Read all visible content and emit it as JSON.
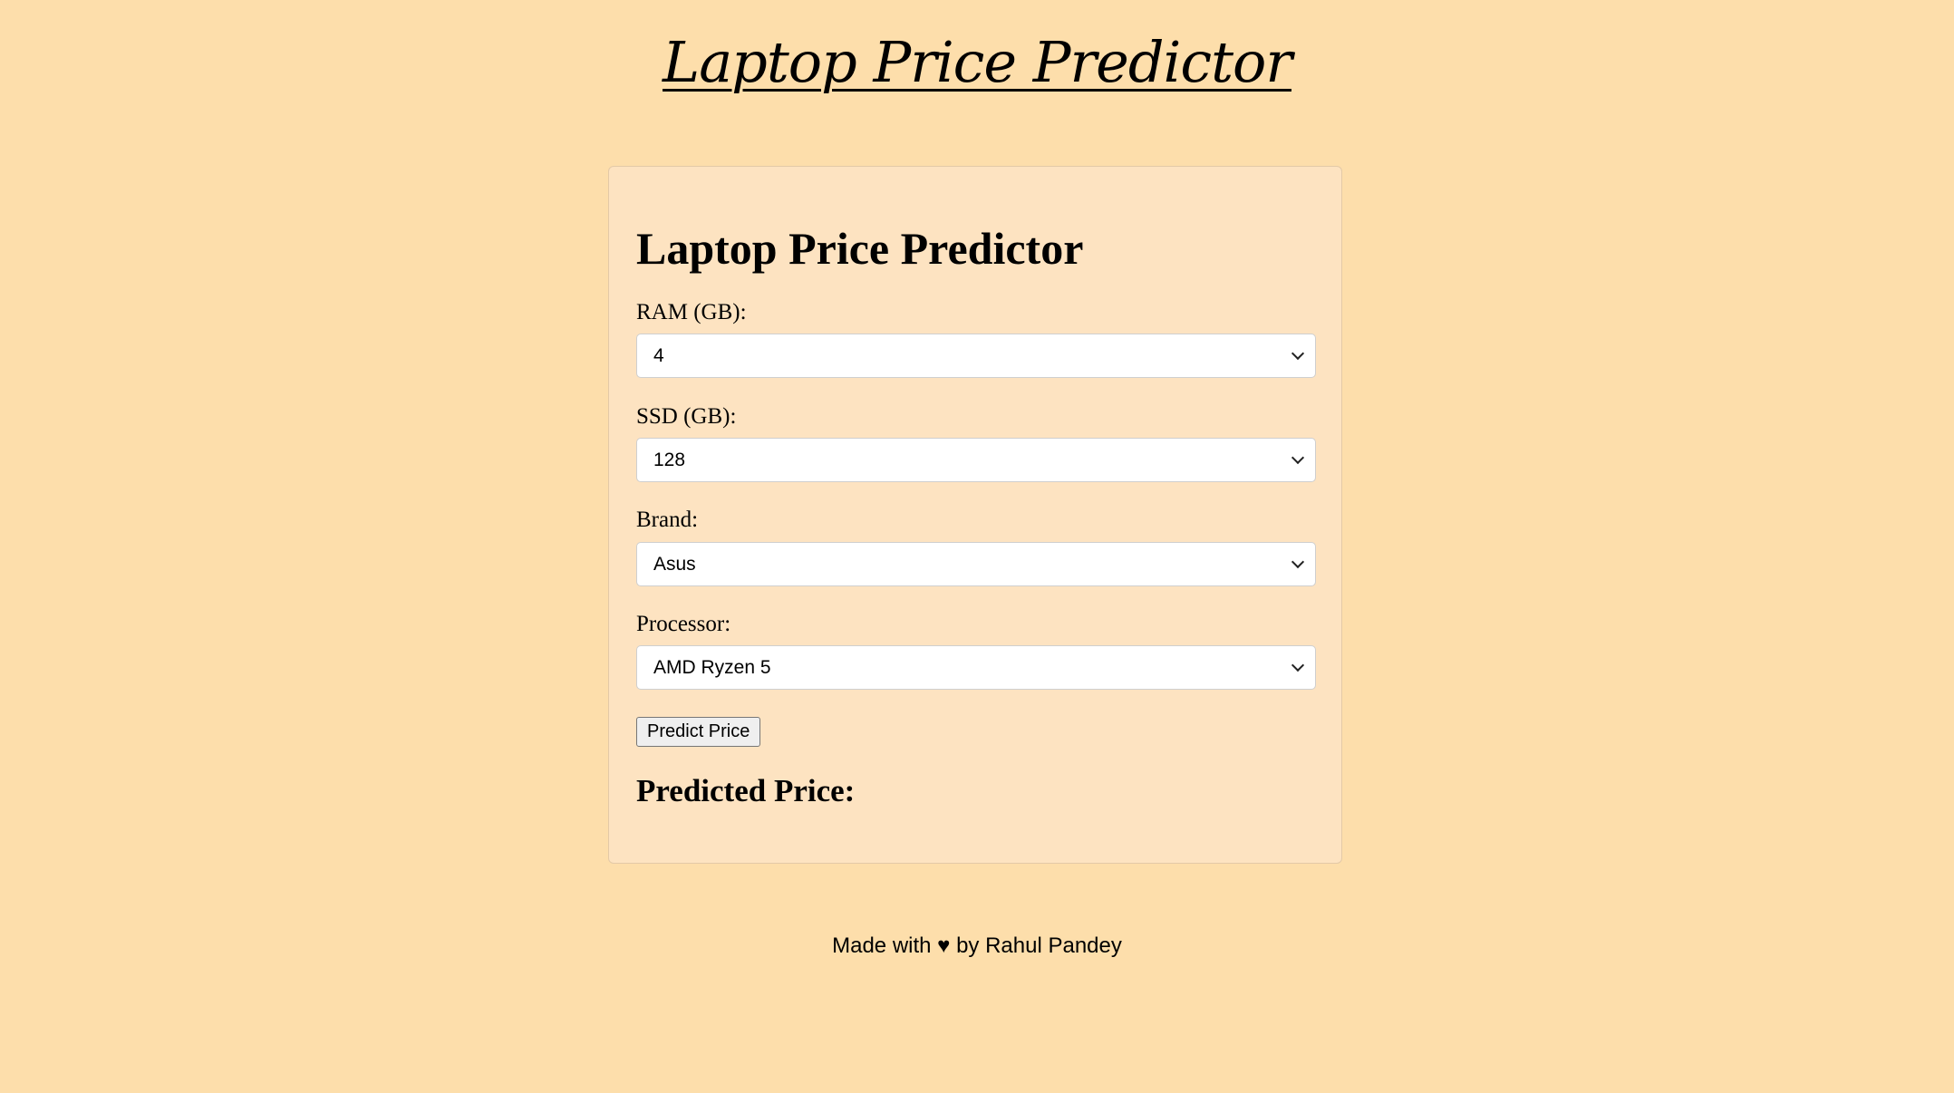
{
  "header": {
    "title": "Laptop Price Predictor"
  },
  "card": {
    "title": "Laptop Price Predictor",
    "fields": [
      {
        "label": "RAM (GB):",
        "value": "4"
      },
      {
        "label": "SSD (GB):",
        "value": "128"
      },
      {
        "label": "Brand:",
        "value": "Asus"
      },
      {
        "label": "Processor:",
        "value": "AMD Ryzen 5"
      }
    ],
    "predict_button_label": "Predict Price",
    "result_label": "Predicted Price:"
  },
  "footer": {
    "text": "Made with ♥ by Rahul Pandey"
  },
  "icons": {
    "select_arrow": "chevron-down-icon"
  },
  "colors": {
    "page_background": "#fddeab",
    "card_background": "#fde3c1"
  }
}
